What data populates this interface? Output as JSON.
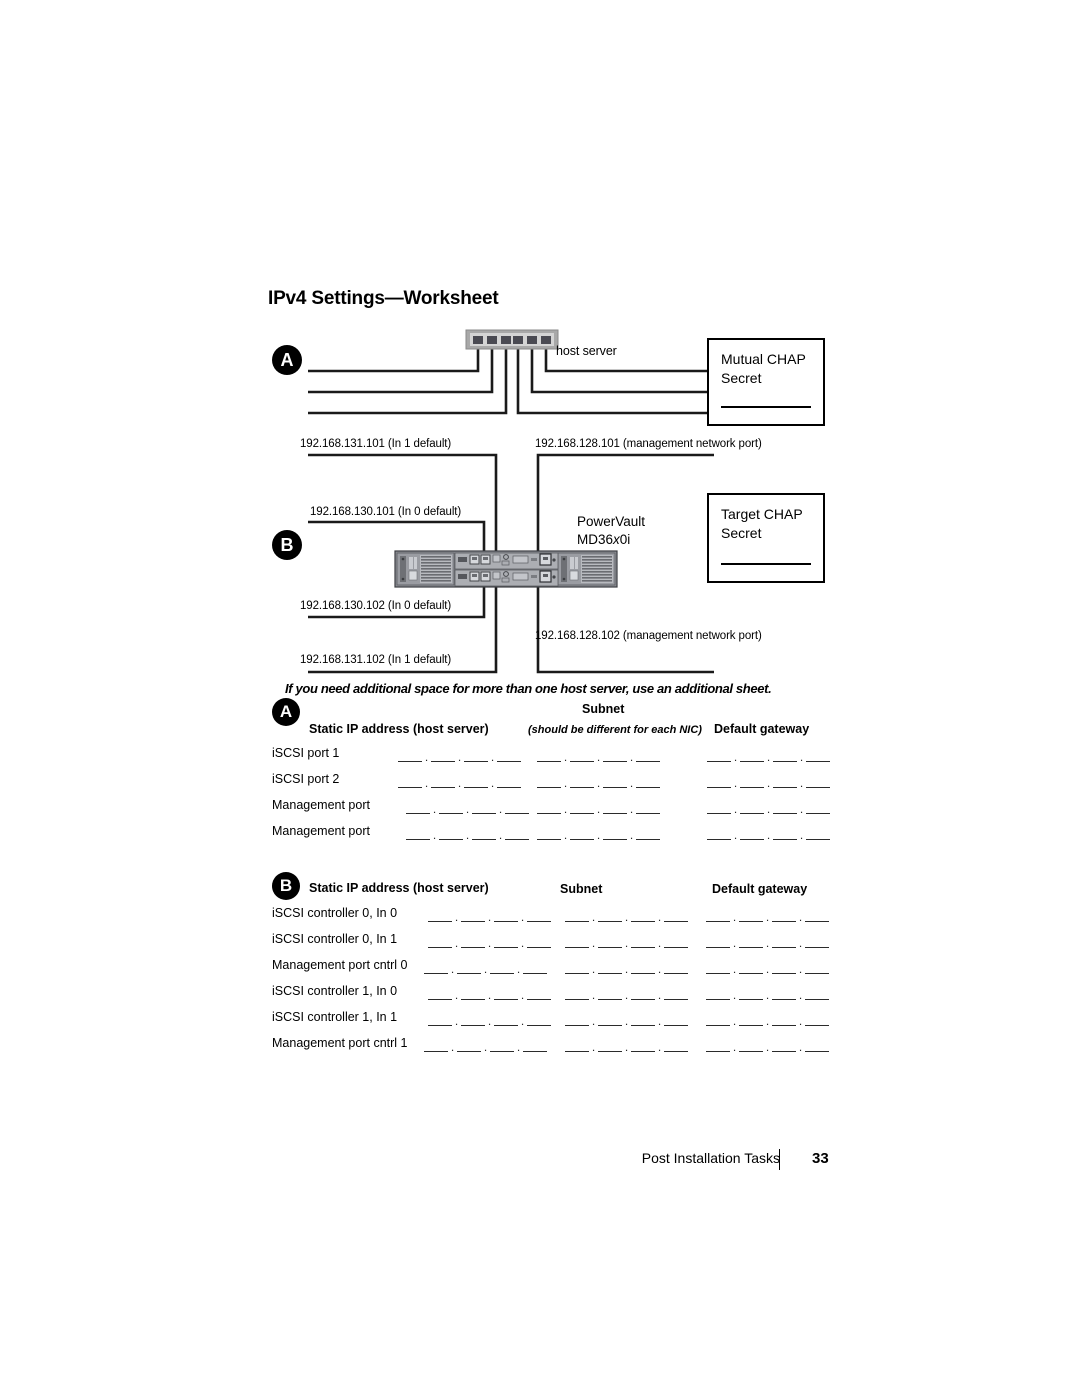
{
  "page": {
    "title": "IPv4 Settings—Worksheet"
  },
  "diagram": {
    "badge_a": "A",
    "badge_b": "B",
    "host_server_label": "host server",
    "powervault_line1": "PowerVault",
    "powervault_line2_pre": "MD36",
    "powervault_line2_italic": "x",
    "powervault_line2_post": "0i",
    "ip_labels": {
      "in1_101": "192.168.131.101 (In 1 default)",
      "mgmt_101": "192.168.128.101 (management network port)",
      "in0_101": "192.168.130.101 (In 0 default)",
      "in0_102": "192.168.130.102 (In 0 default)",
      "mgmt_102": "192.168.128.102 (management network port)",
      "in1_102": "192.168.131.102 (In 1 default)"
    },
    "chap_mutual": {
      "line1": "Mutual CHAP",
      "line2": "Secret"
    },
    "chap_target": {
      "line1": "Target CHAP",
      "line2": "Secret"
    }
  },
  "note": "If you need additional space for more than one host server, use an additional sheet.",
  "worksheet_a": {
    "badge": "A",
    "headers": {
      "col1": "Static IP address (host server)",
      "col2_title": "Subnet",
      "col2_sub": "(should be different for each NIC)",
      "col3": "Default gateway"
    },
    "rows": [
      "iSCSI port 1",
      "iSCSI port 2",
      "Management port",
      "Management port"
    ]
  },
  "worksheet_b": {
    "badge": "B",
    "headers": {
      "col1": "Static IP address (host server)",
      "col2_title": "Subnet",
      "col3": "Default gateway"
    },
    "rows": [
      "iSCSI controller 0, In 0",
      "iSCSI controller 0, In 1",
      "Management port cntrl 0",
      "iSCSI controller 1, In 0",
      "iSCSI controller 1, In 1",
      "Management port cntrl 1"
    ]
  },
  "footer": {
    "section": "Post Installation Tasks",
    "page_number": "33"
  }
}
